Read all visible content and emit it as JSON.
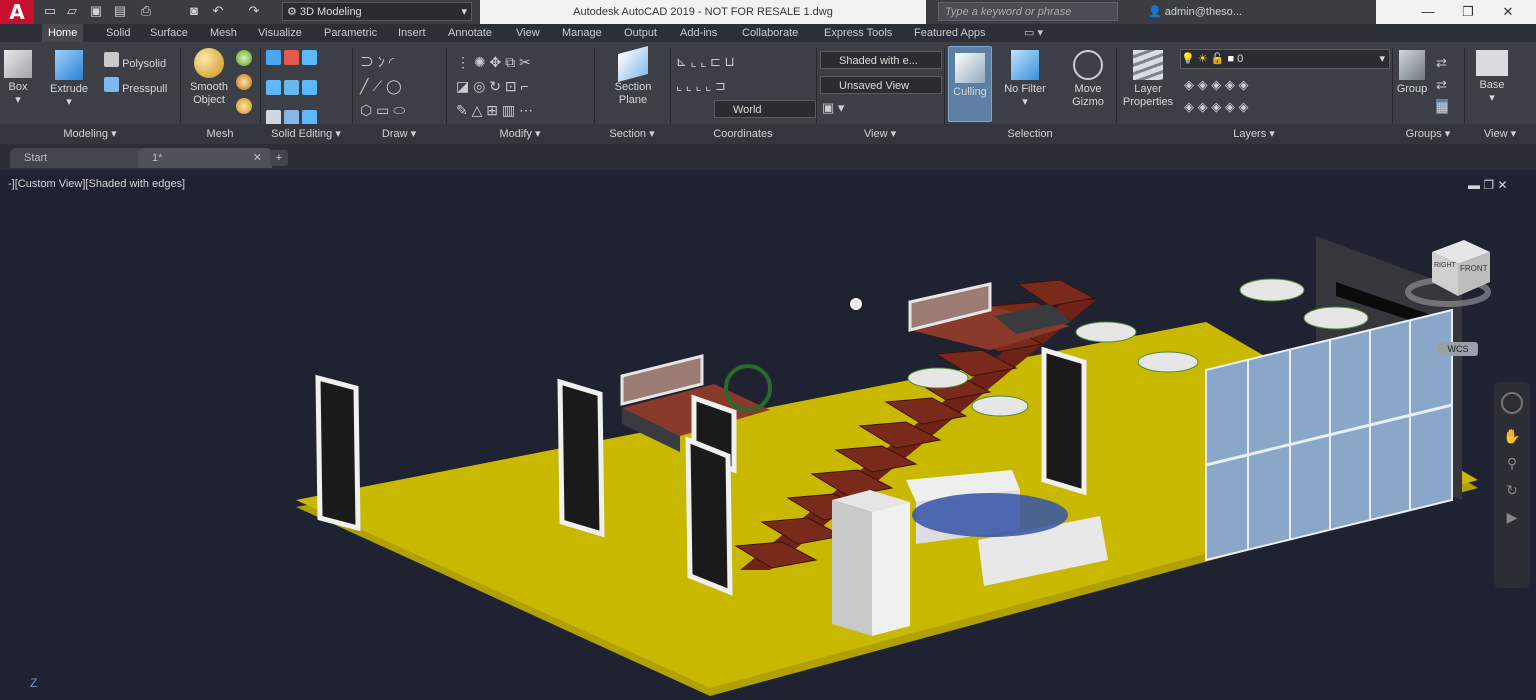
{
  "app": {
    "logo": "A",
    "title": "Autodesk AutoCAD 2019 - NOT FOR RESALE    1.dwg",
    "workspace": "3D Modeling",
    "search_placeholder": "Type a keyword or phrase",
    "user": "admin@theso...",
    "accent": "#c8102e"
  },
  "window_controls": {
    "minimize": "—",
    "restore": "❐",
    "close": "✕"
  },
  "quick_access": [
    "new-icon",
    "open-icon",
    "save-icon",
    "saveas-icon",
    "plot-icon",
    "undo-icon",
    "redo-icon"
  ],
  "ribbon_tabs": [
    "Home",
    "Solid",
    "Surface",
    "Mesh",
    "Visualize",
    "Parametric",
    "Insert",
    "Annotate",
    "View",
    "Manage",
    "Output",
    "Add-ins",
    "Collaborate",
    "Express Tools",
    "Featured Apps"
  ],
  "ribbon": {
    "modeling": {
      "box": "Box",
      "extrude": "Extrude",
      "polysolid": "Polysolid",
      "presspull": "Presspull",
      "title": "Modeling ▾"
    },
    "mesh": {
      "smooth_object": "Smooth Object",
      "title": "Mesh"
    },
    "solid_editing": {
      "title": "Solid Editing ▾"
    },
    "draw": {
      "title": "Draw ▾"
    },
    "modify": {
      "title": "Modify ▾"
    },
    "section": {
      "section_plane": "Section Plane",
      "title": "Section ▾"
    },
    "coordinates": {
      "world": "World",
      "title": "Coordinates"
    },
    "view": {
      "visual_style": "Shaded with e...",
      "named_view": "Unsaved View",
      "title": "View ▾"
    },
    "selection": {
      "culling": "Culling",
      "no_filter": "No Filter",
      "move_gizmo": "Move Gizmo",
      "title": "Selection"
    },
    "layers": {
      "layer_properties": "Layer Properties",
      "current_layer": "0",
      "title": "Layers ▾"
    },
    "groups": {
      "group": "Group",
      "title": "Groups ▾"
    },
    "view2": {
      "base": "Base",
      "title": "View ▾"
    }
  },
  "file_tabs": [
    {
      "label": "Start"
    },
    {
      "label": "1*"
    }
  ],
  "viewport": {
    "label": "-][Custom View][Shaded with edges]",
    "viewcube_face": "FRONT",
    "viewcube_side": "RIGHT",
    "wcs": "WCS",
    "ucs_z": "Z"
  },
  "colors": {
    "floor": "#c8b800",
    "stairs": "#7a2a1a",
    "glass": "#8aa6c8",
    "viewport_bg": "#1f2230"
  }
}
